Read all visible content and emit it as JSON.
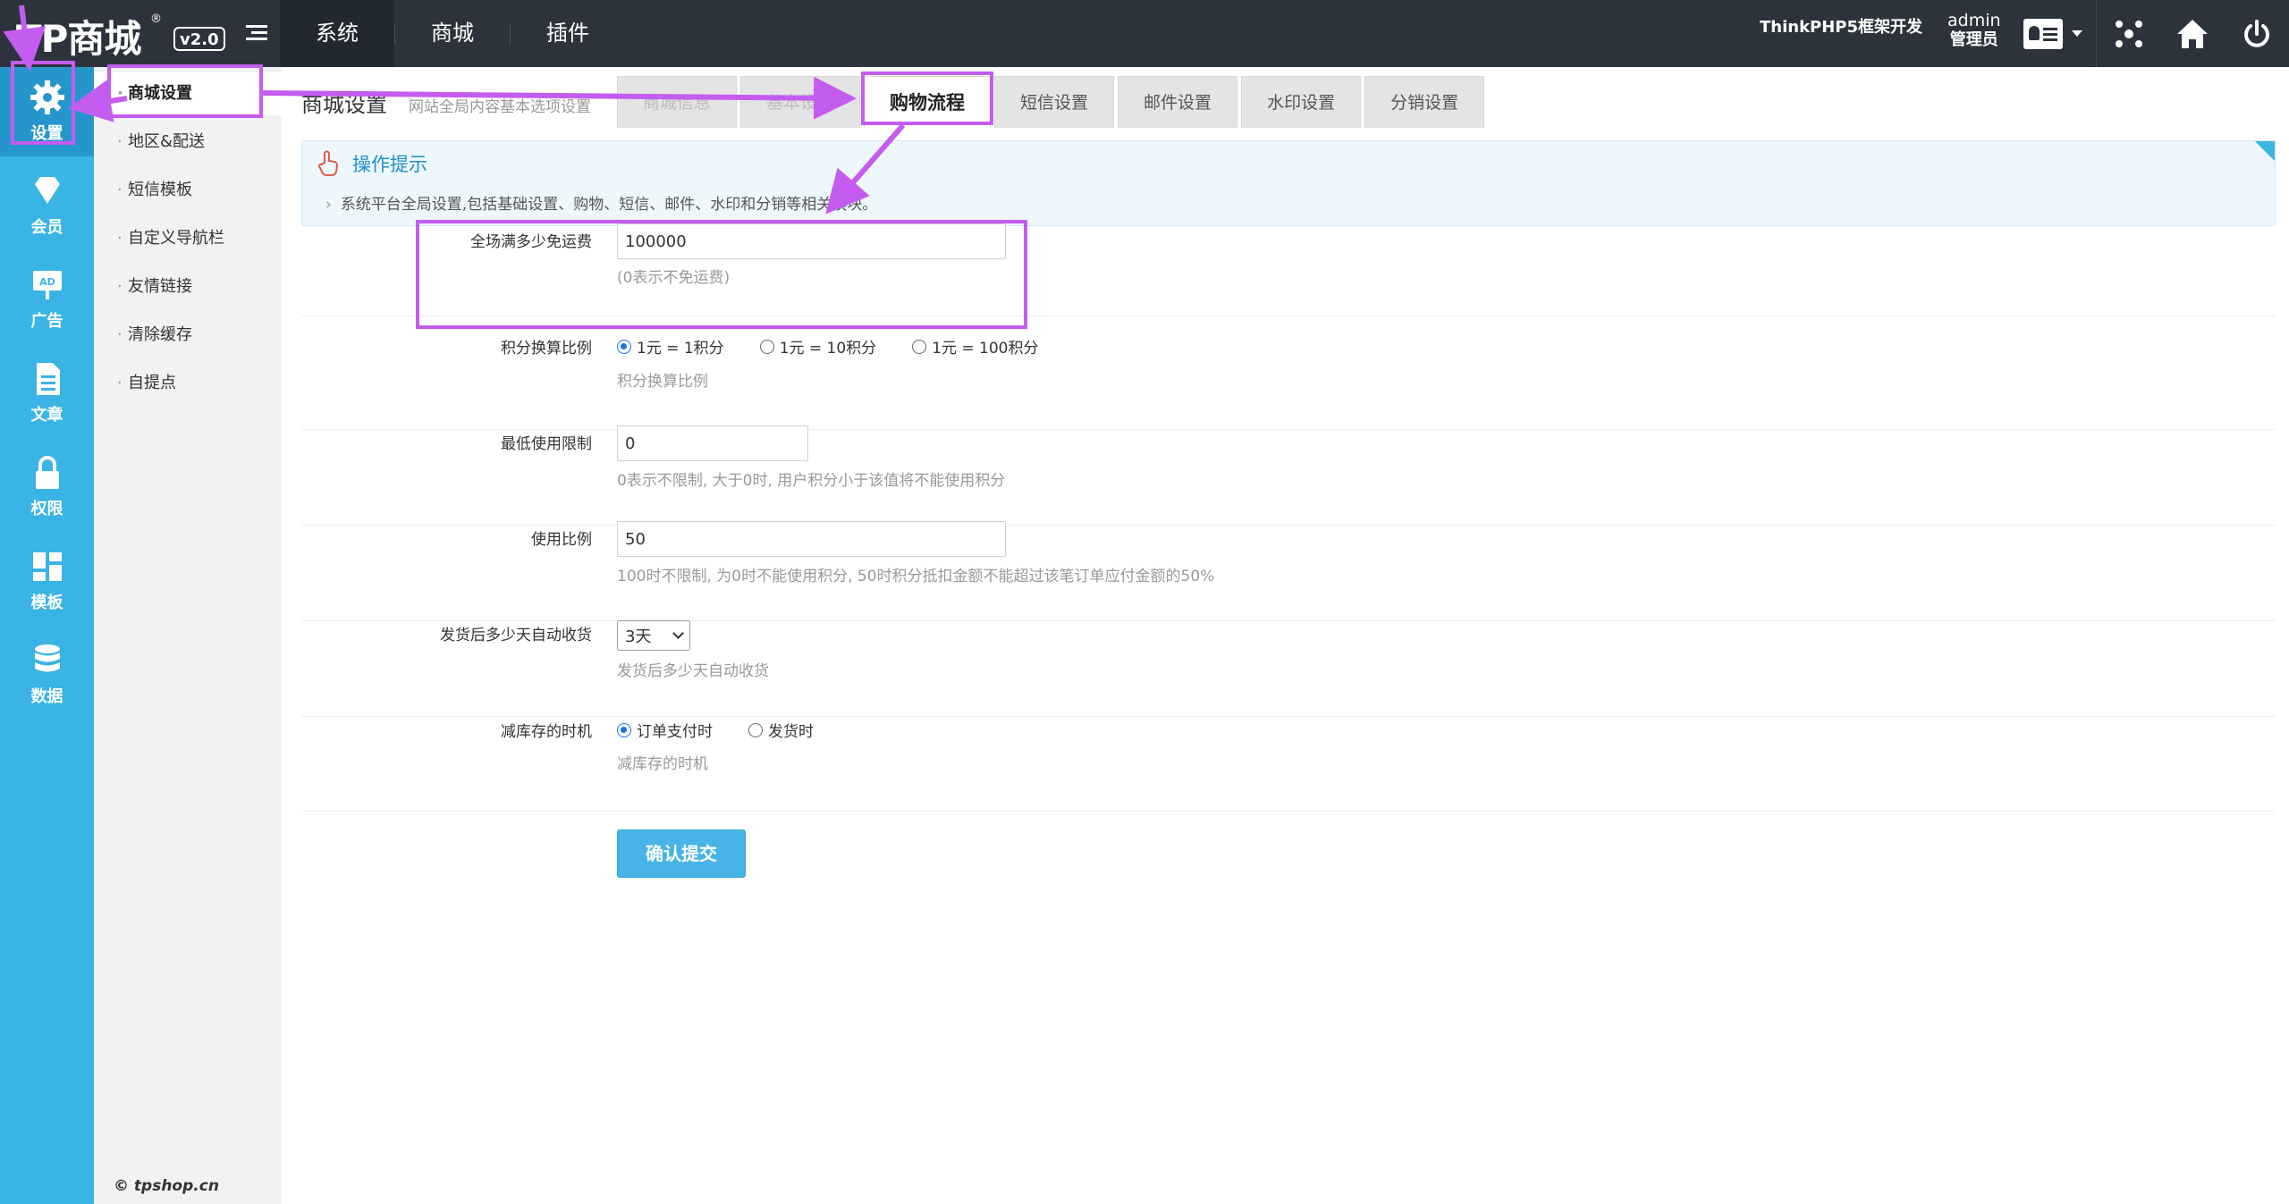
{
  "brand": {
    "logo": "TP商城",
    "reg": "®",
    "version": "v2.0"
  },
  "top_nav": [
    {
      "label": "系统"
    },
    {
      "label": "商城"
    },
    {
      "label": "插件"
    }
  ],
  "top_right": {
    "framework": "ThinkPHP5框架开发",
    "user_name": "admin",
    "user_role": "管理员"
  },
  "rail": [
    {
      "label": "设置",
      "icon": "gear-icon"
    },
    {
      "label": "会员",
      "icon": "diamond-icon"
    },
    {
      "label": "广告",
      "icon": "ad-board-icon"
    },
    {
      "label": "文章",
      "icon": "document-icon"
    },
    {
      "label": "权限",
      "icon": "lock-icon"
    },
    {
      "label": "模板",
      "icon": "grid-icon"
    },
    {
      "label": "数据",
      "icon": "database-icon"
    }
  ],
  "subnav": [
    {
      "label": "商城设置"
    },
    {
      "label": "地区&配送"
    },
    {
      "label": "短信模板"
    },
    {
      "label": "自定义导航栏"
    },
    {
      "label": "友情链接"
    },
    {
      "label": "清除缓存"
    },
    {
      "label": "自提点"
    }
  ],
  "subnav_footer": "© tpshop.cn",
  "page": {
    "title": "商城设置",
    "subtitle": "网站全局内容基本选项设置"
  },
  "tabs": [
    {
      "label": "商城信息"
    },
    {
      "label": "基本设置"
    },
    {
      "label": "购物流程"
    },
    {
      "label": "短信设置"
    },
    {
      "label": "邮件设置"
    },
    {
      "label": "水印设置"
    },
    {
      "label": "分销设置"
    }
  ],
  "tip": {
    "title": "操作提示",
    "text": "系统平台全局设置,包括基础设置、购物、短信、邮件、水印和分销等相关模块。"
  },
  "form": {
    "free_shipping": {
      "label": "全场满多少免运费",
      "value": "100000",
      "hint": "(0表示不免运费)"
    },
    "points_ratio": {
      "label": "积分换算比例",
      "options": [
        "1元 = 1积分",
        "1元 = 10积分",
        "1元 = 100积分"
      ],
      "selected": "1元 = 1积分",
      "hint": "积分换算比例"
    },
    "min_limit": {
      "label": "最低使用限制",
      "value": "0",
      "hint": "0表示不限制, 大于0时, 用户积分小于该值将不能使用积分"
    },
    "use_ratio": {
      "label": "使用比例",
      "value": "50",
      "hint": "100时不限制, 为0时不能使用积分, 50时积分抵扣金额不能超过该笔订单应付金额的50%"
    },
    "auto_receive": {
      "label": "发货后多少天自动收货",
      "value": "3天",
      "hint": "发货后多少天自动收货"
    },
    "stock_timing": {
      "label": "减库存的时机",
      "options": [
        "订单支付时",
        "发货时"
      ],
      "selected": "订单支付时",
      "hint": "减库存的时机"
    },
    "submit_label": "确认提交"
  },
  "colors": {
    "topbar": "#2c333c",
    "rail": "#39b4e4",
    "accent": "#47b3e6",
    "annotation": "#c45cf0"
  }
}
